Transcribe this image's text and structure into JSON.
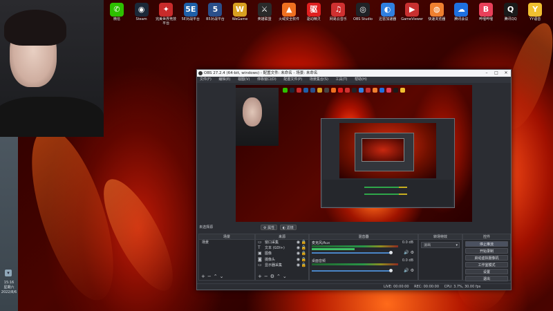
{
  "desktop_icons": [
    {
      "label": "微信",
      "glyph": "✆",
      "color": "#2dc100"
    },
    {
      "label": "Steam",
      "glyph": "◉",
      "color": "#1b2838"
    },
    {
      "label": "完美世界竞技平台",
      "glyph": "✦",
      "color": "#c82b2b"
    },
    {
      "label": "5E对战平台",
      "glyph": "5E",
      "color": "#1e5fa8"
    },
    {
      "label": "B5对战平台",
      "glyph": "5",
      "color": "#2a4f8a"
    },
    {
      "label": "WeGame",
      "glyph": "W",
      "color": "#d8a020"
    },
    {
      "label": "英雄联盟",
      "glyph": "⚔",
      "color": "#2a2a2a"
    },
    {
      "label": "火绒安全软件",
      "glyph": "▲",
      "color": "#f07020"
    },
    {
      "label": "驱动精灵",
      "glyph": "驱",
      "color": "#e02020"
    },
    {
      "label": "网易云音乐",
      "glyph": "♫",
      "color": "#d03030"
    },
    {
      "label": "OBS Studio",
      "glyph": "◎",
      "color": "#202226"
    },
    {
      "label": "迅雷加速器",
      "glyph": "◐",
      "color": "#3080e0"
    },
    {
      "label": "GameViewer",
      "glyph": "▶",
      "color": "#c83030"
    },
    {
      "label": "快速浏览器",
      "glyph": "◍",
      "color": "#f08030"
    },
    {
      "label": "腾讯会议",
      "glyph": "☁",
      "color": "#1e70e0"
    },
    {
      "label": "哔哩哔哩",
      "glyph": "B",
      "color": "#e8405a"
    },
    {
      "label": "腾讯QQ",
      "glyph": "Q",
      "color": "#1a1a1a"
    },
    {
      "label": "YY语音",
      "glyph": "Y",
      "color": "#f0c030"
    }
  ],
  "taskbar": {
    "time": "15:16",
    "weekday": "星期六",
    "date": "2022/8/6"
  },
  "obs": {
    "title": "OBS 27.2.4 (64-bit, windows) - 配置文件: 未命名 - 场景: 未命名",
    "menu": [
      "文件(F)",
      "编辑(E)",
      "视图(V)",
      "停靠窗口(D)",
      "配置文件(P)",
      "场景集合(S)",
      "工具(T)",
      "帮助(H)"
    ],
    "no_source_label": "未选择源",
    "properties_button": "属性",
    "filters_button": "滤镜",
    "scenes": {
      "title": "场景",
      "items": [
        "场景"
      ]
    },
    "sources": {
      "title": "来源",
      "items": [
        {
          "icon": "window-icon",
          "glyph": "▭",
          "label": "窗口采集"
        },
        {
          "icon": "text-icon",
          "glyph": "T",
          "label": "文本 (GDI+)"
        },
        {
          "icon": "image-icon",
          "glyph": "▣",
          "label": "图像"
        },
        {
          "icon": "camera-icon",
          "glyph": "◙",
          "label": "摄像头"
        },
        {
          "icon": "display-icon",
          "glyph": "▭",
          "label": "显示器采集"
        }
      ]
    },
    "mixer": {
      "title": "混音器",
      "channels": [
        {
          "name": "麦克风/Aux",
          "db": "0.0 dB"
        },
        {
          "name": "桌面音频",
          "db": "0.0 dB"
        }
      ]
    },
    "transitions": {
      "title": "转场特效",
      "selected": "淡出"
    },
    "controls": {
      "title": "控件",
      "buttons": [
        "停止推流",
        "开始录制",
        "启动虚拟摄像机",
        "工作室模式",
        "设置",
        "退出"
      ]
    },
    "status": {
      "live": "LIVE: 00:00:00",
      "rec": "REC: 00:00:00",
      "cpu": "CPU: 3.7%, 30.00 fps"
    }
  }
}
